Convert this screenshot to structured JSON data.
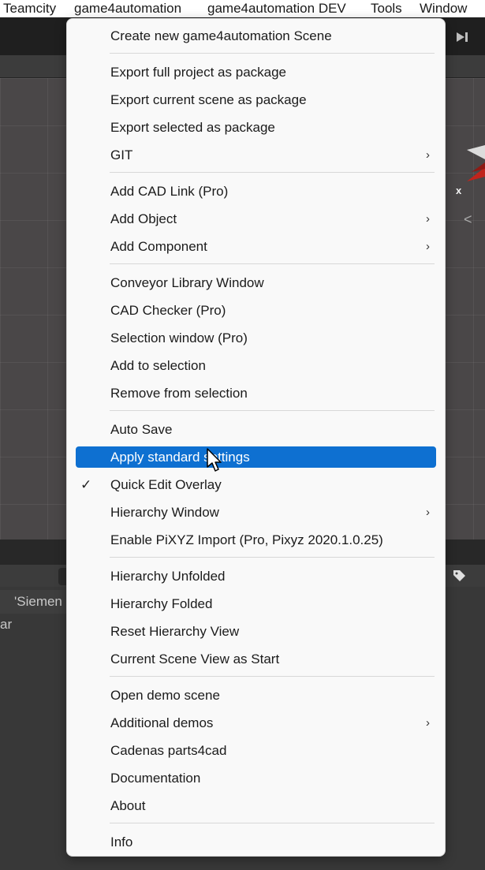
{
  "menubar": {
    "items": [
      "Teamcity",
      "game4automation",
      "game4automation DEV",
      "Tools",
      "Window"
    ]
  },
  "hierarchy": {
    "tab_label": "'Siemen",
    "row_text": "ar"
  },
  "menu": {
    "items": [
      {
        "label": "Create new game4automation Scene"
      },
      {
        "label": "Export full project as package"
      },
      {
        "label": "Export current scene as package"
      },
      {
        "label": "Export selected as package"
      },
      {
        "label": "GIT",
        "submenu": true
      },
      {
        "label": "Add CAD Link (Pro)"
      },
      {
        "label": "Add Object",
        "submenu": true
      },
      {
        "label": "Add Component",
        "submenu": true
      },
      {
        "label": "Conveyor Library Window"
      },
      {
        "label": "CAD Checker (Pro)"
      },
      {
        "label": "Selection window (Pro)"
      },
      {
        "label": "Add to selection"
      },
      {
        "label": "Remove from selection"
      },
      {
        "label": "Auto Save"
      },
      {
        "label": "Apply standard settings",
        "highlighted": true
      },
      {
        "label": "Quick Edit Overlay",
        "checked": true
      },
      {
        "label": "Hierarchy Window",
        "submenu": true
      },
      {
        "label": "Enable PiXYZ Import (Pro, Pixyz 2020.1.0.25)"
      },
      {
        "label": "Hierarchy Unfolded"
      },
      {
        "label": "Hierarchy Folded"
      },
      {
        "label": "Reset Hierarchy View"
      },
      {
        "label": "Current Scene View as Start"
      },
      {
        "label": "Open demo scene"
      },
      {
        "label": "Additional demos",
        "submenu": true
      },
      {
        "label": "Cadenas parts4cad"
      },
      {
        "label": "Documentation"
      },
      {
        "label": "About"
      },
      {
        "label": "Info"
      }
    ],
    "submenu_glyph": "›",
    "check_glyph": "✓"
  },
  "colors": {
    "highlight": "#0e70d1",
    "menu_bg": "#f9f9f9",
    "scene_bg": "#4a4748"
  },
  "icons": [
    "lightbulb-icon",
    "speaker-icon",
    "step-forward-icon",
    "axis-gizmo-icon",
    "tag-icon",
    "mouse-cursor-icon"
  ]
}
